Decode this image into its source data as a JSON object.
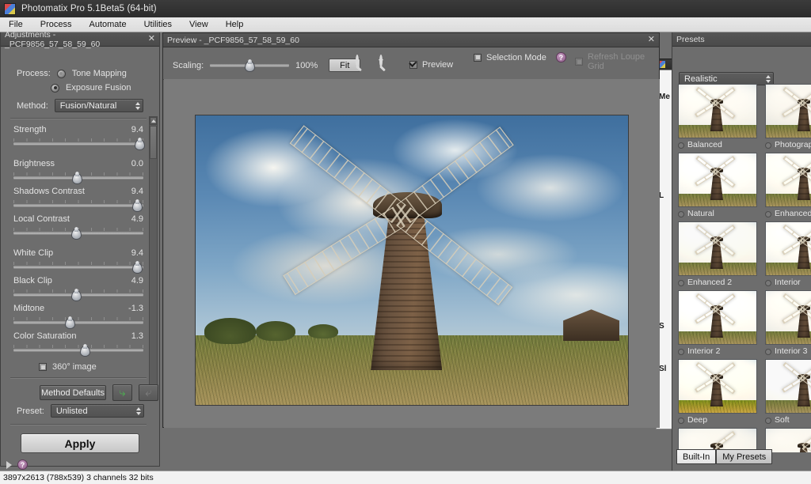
{
  "window": {
    "title": "Photomatix Pro 5.1Beta5 (64-bit)",
    "icon": "photomatix-logo-icon"
  },
  "menubar": {
    "items": [
      {
        "label": "File"
      },
      {
        "label": "Process"
      },
      {
        "label": "Automate"
      },
      {
        "label": "Utilities"
      },
      {
        "label": "View"
      },
      {
        "label": "Help"
      }
    ]
  },
  "adjustments": {
    "title": "Adjustments - _PCF9856_57_58_59_60",
    "close_label": "✕",
    "process_label": "Process:",
    "process_options": [
      {
        "label": "Tone Mapping",
        "selected": false
      },
      {
        "label": "Exposure Fusion",
        "selected": true
      }
    ],
    "method_label": "Method:",
    "method_value": "Fusion/Natural",
    "sliders": [
      {
        "name": "Strength",
        "value": "9.4",
        "pct": 97
      },
      {
        "name": "Brightness",
        "value": "0.0",
        "pct": 49
      },
      {
        "name": "Shadows Contrast",
        "value": "9.4",
        "pct": 95
      },
      {
        "name": "Local Contrast",
        "value": "4.9",
        "pct": 48
      },
      {
        "name": "White Clip",
        "value": "9.4",
        "pct": 95
      },
      {
        "name": "Black Clip",
        "value": "4.9",
        "pct": 48
      },
      {
        "name": "Midtone",
        "value": "-1.3",
        "pct": 43
      },
      {
        "name": "Color Saturation",
        "value": "1.3",
        "pct": 55
      }
    ],
    "image360_label": "360° image",
    "image360_checked": false,
    "method_defaults_label": "Method Defaults",
    "undo_icon": "undo-arrow-icon",
    "redo_icon": "redo-arrow-icon",
    "preset_label": "Preset:",
    "preset_value": "Unlisted",
    "apply_label": "Apply",
    "expand_icon": "expand-triangle-icon",
    "help_icon": "help-question-icon",
    "help_glyph": "?"
  },
  "preview": {
    "title": "Preview - _PCF9856_57_58_59_60",
    "close_label": "✕",
    "scaling_label": "Scaling:",
    "scaling_value": "100%",
    "scaling_pct": 50,
    "fit_label": "Fit",
    "zoom_out_icon": "zoom-out-magnifier-icon",
    "zoom_out_glyph": "−",
    "zoom_in_icon": "zoom-in-magnifier-icon",
    "zoom_in_glyph": "+",
    "preview_checkbox_label": "Preview",
    "preview_checked": true,
    "selection_mode_label": "Selection Mode",
    "selection_mode_checked": false,
    "selection_help_glyph": "?",
    "disabled_option_label": "Refresh Loupe Grid",
    "disabled_option_checked": false,
    "photo_alt": "windmill-photograph"
  },
  "behind_window": {
    "labels": [
      "Me",
      "L",
      "S",
      "Sl"
    ]
  },
  "presets": {
    "title": "Presets",
    "category_value": "Realistic",
    "items": [
      {
        "label": "Balanced",
        "selected": false
      },
      {
        "label": "Photograp",
        "selected": false
      },
      {
        "label": "Natural",
        "selected": false
      },
      {
        "label": "Enhanced",
        "selected": false
      },
      {
        "label": "Enhanced 2",
        "selected": false
      },
      {
        "label": "Interior",
        "selected": false
      },
      {
        "label": "Interior 2",
        "selected": false
      },
      {
        "label": "Interior 3",
        "selected": false
      },
      {
        "label": "Deep",
        "selected": false
      },
      {
        "label": "Soft",
        "selected": false
      }
    ],
    "tabs": [
      {
        "label": "Built-In",
        "active": true
      },
      {
        "label": "My Presets",
        "active": false
      }
    ]
  },
  "statusbar": {
    "text": "3897x2613 (788x539) 3 channels 32 bits"
  },
  "colors": {
    "panel_bg": "#6d6d6d",
    "titlebar_bg": "#333333",
    "accent_help": "#8d5c88",
    "apply_bg": "#d8d8d8"
  }
}
